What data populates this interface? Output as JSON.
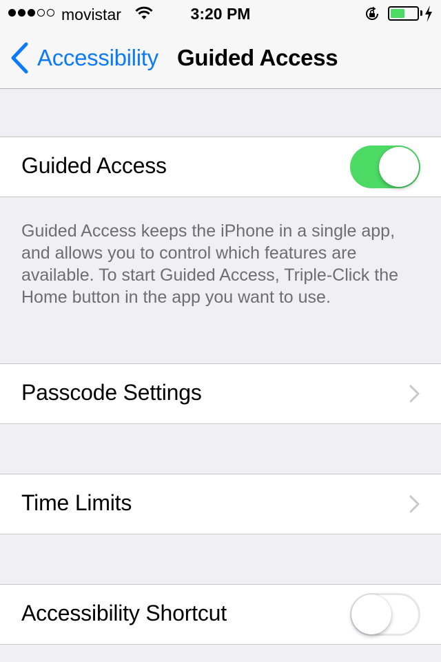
{
  "status_bar": {
    "signal_bars": [
      true,
      true,
      true,
      false,
      false
    ],
    "carrier": "movistar",
    "time": "3:20 PM",
    "battery_level": 0.55,
    "icons": [
      "wifi-icon",
      "rotation-lock-icon",
      "battery-icon",
      "charging-bolt-icon"
    ]
  },
  "nav": {
    "back_label": "Accessibility",
    "title": "Guided Access"
  },
  "settings": {
    "guided_access": {
      "label": "Guided Access",
      "enabled": true
    },
    "description": "Guided Access keeps the iPhone in a single app, and allows you to control which features are available. To start Guided Access, Triple-Click the Home button in the app you want to use.",
    "passcode_settings": {
      "label": "Passcode Settings"
    },
    "time_limits": {
      "label": "Time Limits"
    },
    "accessibility_shortcut": {
      "label": "Accessibility Shortcut",
      "enabled": false
    }
  },
  "colors": {
    "accent": "#0d7afa",
    "switch_on": "#4cd964",
    "background": "#efeff4",
    "footer_text": "#6d6d72"
  }
}
